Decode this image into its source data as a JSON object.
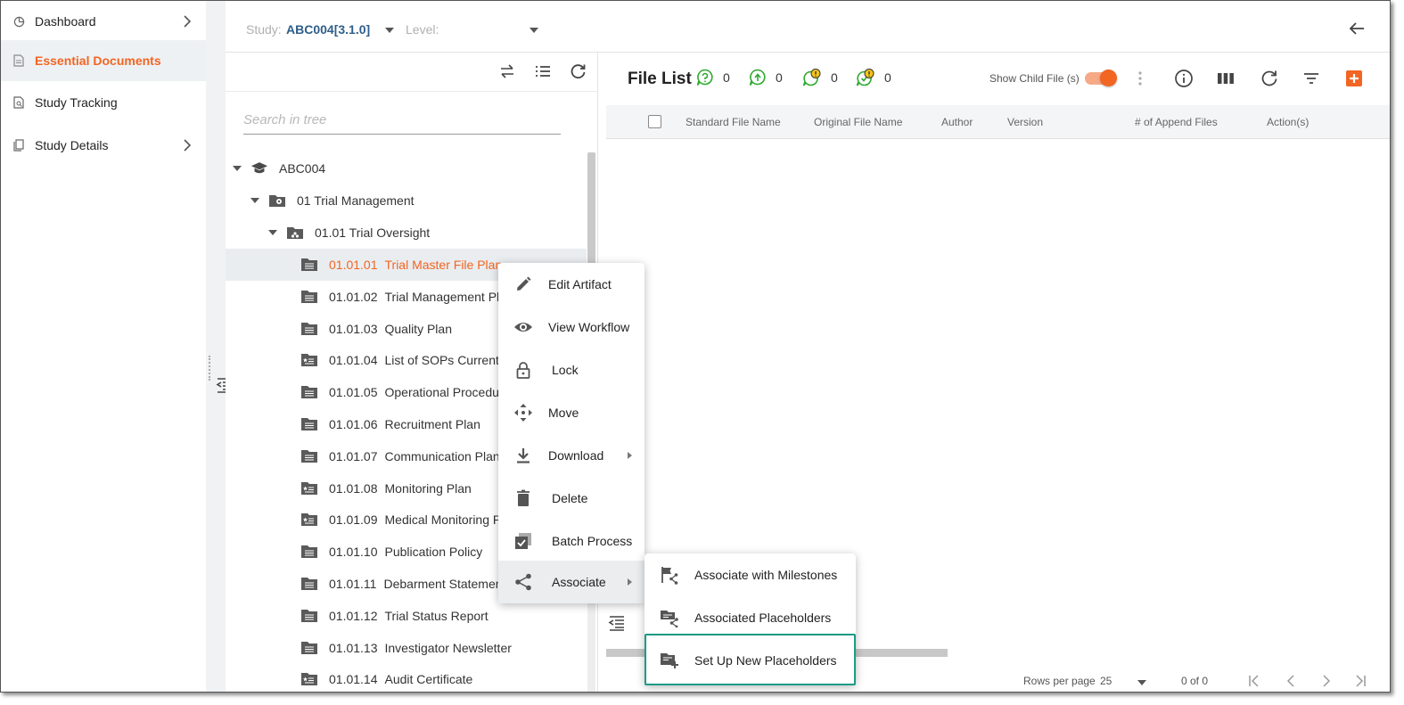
{
  "nav": {
    "items": [
      {
        "label": "Dashboard",
        "icon": "pie-chart-icon",
        "has_chevron": true
      },
      {
        "label": "Essential Documents",
        "icon": "document-icon",
        "active": true
      },
      {
        "label": "Study Tracking",
        "icon": "document-search-icon"
      },
      {
        "label": "Study Details",
        "icon": "copy-document-icon",
        "has_chevron": true
      }
    ]
  },
  "filter": {
    "study_label": "Study:",
    "study_value": "ABC004[3.1.0]",
    "level_label": "Level:",
    "back_icon": "arrow-left-icon"
  },
  "tree": {
    "search_placeholder": "Search in tree",
    "root": "ABC004",
    "zone": "01  Trial Management",
    "section": "01.01  Trial Oversight",
    "artifacts": [
      {
        "code": "01.01.01",
        "name": "Trial Master File Plan",
        "selected": true
      },
      {
        "code": "01.01.02",
        "name": "Trial Management Pl"
      },
      {
        "code": "01.01.03",
        "name": "Quality Plan"
      },
      {
        "code": "01.01.04",
        "name": "List of SOPs Current"
      },
      {
        "code": "01.01.05",
        "name": "Operational Procedur"
      },
      {
        "code": "01.01.06",
        "name": "Recruitment Plan"
      },
      {
        "code": "01.01.07",
        "name": "Communication Plan"
      },
      {
        "code": "01.01.08",
        "name": "Monitoring Plan"
      },
      {
        "code": "01.01.09",
        "name": "Medical Monitoring P"
      },
      {
        "code": "01.01.10",
        "name": "Publication Policy"
      },
      {
        "code": "01.01.11",
        "name": "Debarment Statemen"
      },
      {
        "code": "01.01.12",
        "name": "Trial Status Report"
      },
      {
        "code": "01.01.13",
        "name": "Investigator Newsletter"
      },
      {
        "code": "01.01.14",
        "name": "Audit Certificate"
      }
    ]
  },
  "file_list": {
    "title": "File List",
    "stats": [
      {
        "icon": "question-bubble-icon",
        "count": "0",
        "color": "#2eaa2e"
      },
      {
        "icon": "upload-bubble-icon",
        "count": "0",
        "color": "#2eaa2e"
      },
      {
        "icon": "warning-bubble-icon",
        "count": "0",
        "color": "#2eaa2e"
      },
      {
        "icon": "check-warning-bubble-icon",
        "count": "0",
        "color": "#2eaa2e"
      }
    ],
    "show_child_label": "Show Child File (s)",
    "show_child_on": true,
    "columns": [
      "Standard File Name",
      "Original File Name",
      "Author",
      "Version",
      "# of Append Files",
      "Action(s)"
    ],
    "rows_per_page_label": "Rows per page",
    "rows_per_page": "25",
    "page_info": "0 of 0"
  },
  "context_menu": {
    "items": [
      {
        "label": "Edit Artifact",
        "icon": "pencil-icon"
      },
      {
        "label": "View Workflow",
        "icon": "eye-icon"
      },
      {
        "label": "Lock",
        "icon": "lock-icon"
      },
      {
        "label": "Move",
        "icon": "move-arrows-icon"
      },
      {
        "label": "Download",
        "icon": "download-icon",
        "submenu": true
      },
      {
        "label": "Delete",
        "icon": "trash-icon"
      },
      {
        "label": "Batch Process",
        "icon": "batch-check-icon"
      },
      {
        "label": "Associate",
        "icon": "share-icon",
        "submenu": true,
        "hover": true
      }
    ]
  },
  "associate_menu": {
    "items": [
      {
        "label": "Associate with Milestones",
        "icon": "flag-share-icon"
      },
      {
        "label": "Associated Placeholders",
        "icon": "placeholder-share-icon"
      },
      {
        "label": "Set Up New Placeholders",
        "icon": "placeholder-add-icon",
        "highlighted": true
      }
    ]
  },
  "colors": {
    "accent": "#f26522",
    "study": "#2f5e8a",
    "highlight": "#1c9a85",
    "status_green": "#2eaa2e"
  }
}
